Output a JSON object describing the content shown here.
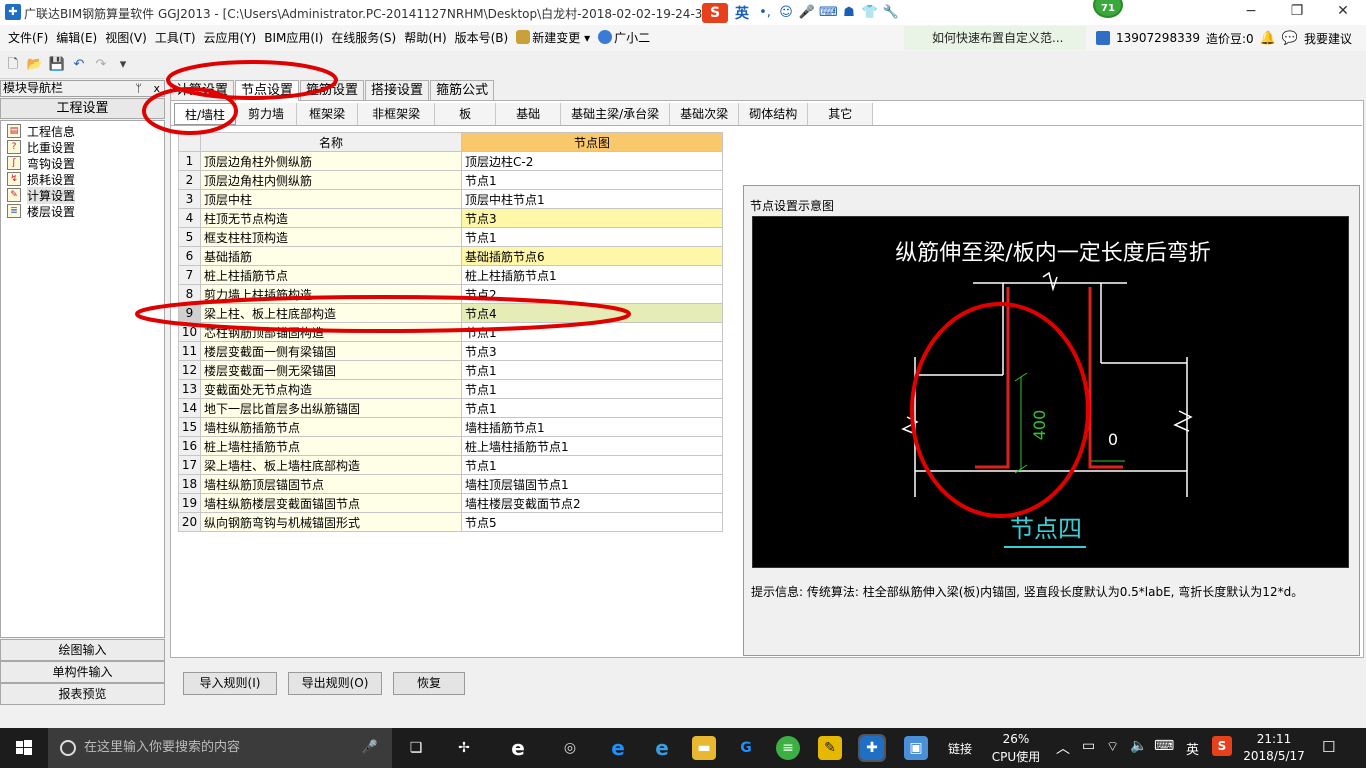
{
  "window": {
    "title": "广联达BIM钢筋算量软件 GGJ2013 - [C:\\Users\\Administrator.PC-20141127NRHM\\Desktop\\白龙村-2018-02-02-19-24-35",
    "minimize": "−",
    "maximize": "❐",
    "close": "✕",
    "score_badge": "71"
  },
  "ime": {
    "lang": "英",
    "items": [
      "•,",
      "☺",
      "🎤",
      "⌨",
      "☗",
      "👕",
      "🔧"
    ]
  },
  "menu": [
    "文件(F)",
    "编辑(E)",
    "视图(V)",
    "工具(T)",
    "云应用(Y)",
    "BIM应用(I)",
    "在线服务(S)",
    "帮助(H)",
    "版本号(B)",
    "新建变更",
    "广小二"
  ],
  "tip_link": "如何快速布置自定义范...",
  "user": {
    "phone": "13907298339",
    "price_beans": "造价豆:0",
    "suggest": "我要建议"
  },
  "nav": {
    "header": "模块导航栏",
    "pin": "ᛘ",
    "close": "x",
    "section": "工程设置",
    "items": [
      "工程信息",
      "比重设置",
      "弯钩设置",
      "损耗设置",
      "计算设置",
      "楼层设置"
    ],
    "bottom": [
      "绘图输入",
      "单构件输入",
      "报表预览"
    ]
  },
  "main_tabs": [
    "计算设置",
    "节点设置",
    "箍筋设置",
    "搭接设置",
    "箍筋公式"
  ],
  "sub_tabs": [
    "柱/墙柱",
    "剪力墙",
    "框架梁",
    "非框架梁",
    "板",
    "基础",
    "基础主梁/承台梁",
    "基础次梁",
    "砌体结构",
    "其它"
  ],
  "table": {
    "headers": [
      "名称",
      "节点图"
    ],
    "rows": [
      {
        "n": "1",
        "name": "顶层边角柱外侧纵筋",
        "node": "顶层边柱C-2"
      },
      {
        "n": "2",
        "name": "顶层边角柱内侧纵筋",
        "node": "节点1"
      },
      {
        "n": "3",
        "name": "顶层中柱",
        "node": "顶层中柱节点1"
      },
      {
        "n": "4",
        "name": "柱顶无节点构造",
        "node": "节点3"
      },
      {
        "n": "5",
        "name": "框支柱柱顶构造",
        "node": "节点1"
      },
      {
        "n": "6",
        "name": "基础插筋",
        "node": "基础插筋节点6"
      },
      {
        "n": "7",
        "name": "桩上柱插筋节点",
        "node": "桩上柱插筋节点1"
      },
      {
        "n": "8",
        "name": "剪力墙上柱插筋构造",
        "node": "节点2"
      },
      {
        "n": "9",
        "name": "梁上柱、板上柱底部构造",
        "node": "节点4"
      },
      {
        "n": "10",
        "name": "芯柱钢筋顶部锚固构造",
        "node": "节点1"
      },
      {
        "n": "11",
        "name": "楼层变截面一侧有梁锚固",
        "node": "节点3"
      },
      {
        "n": "12",
        "name": "楼层变截面一侧无梁锚固",
        "node": "节点1"
      },
      {
        "n": "13",
        "name": "变截面处无节点构造",
        "node": "节点1"
      },
      {
        "n": "14",
        "name": "地下一层比首层多出纵筋锚固",
        "node": "节点1"
      },
      {
        "n": "15",
        "name": "墙柱纵筋插筋节点",
        "node": "墙柱插筋节点1"
      },
      {
        "n": "16",
        "name": "桩上墙柱插筋节点",
        "node": "桩上墙柱插筋节点1"
      },
      {
        "n": "17",
        "name": "梁上墙柱、板上墙柱底部构造",
        "node": "节点1"
      },
      {
        "n": "18",
        "name": "墙柱纵筋顶层锚固节点",
        "node": "墙柱顶层锚固节点1"
      },
      {
        "n": "19",
        "name": "墙柱纵筋楼层变截面锚固节点",
        "node": "墙柱楼层变截面节点2"
      },
      {
        "n": "20",
        "name": "纵向钢筋弯钩与机械锚固形式",
        "node": "节点5"
      }
    ]
  },
  "diagram": {
    "panel_title": "节点设置示意图",
    "heading": "纵筋伸至梁/板内一定长度后弯折",
    "dim_vertical": "400",
    "dim_bend": "0",
    "caption": "节点四",
    "hint": "提示信息: 传统算法: 柱全部纵筋伸入梁(板)内锚固, 竖直段长度默认为0.5*labE, 弯折长度默认为12*d。",
    "colors": {
      "background": "#000000",
      "rebar": "#e0201e",
      "dimension": "#2ec62e",
      "caption": "#33d0d8"
    }
  },
  "buttons": {
    "import": "导入规则(I)",
    "export": "导出规则(O)",
    "restore": "恢复"
  },
  "taskbar": {
    "search_placeholder": "在这里输入你要搜索的内容",
    "link": "链接",
    "cpu_value": "26%",
    "cpu_label": "CPU使用",
    "lang": "英",
    "time": "21:11",
    "date": "2018/5/17"
  },
  "annotation_color": "#e00000"
}
